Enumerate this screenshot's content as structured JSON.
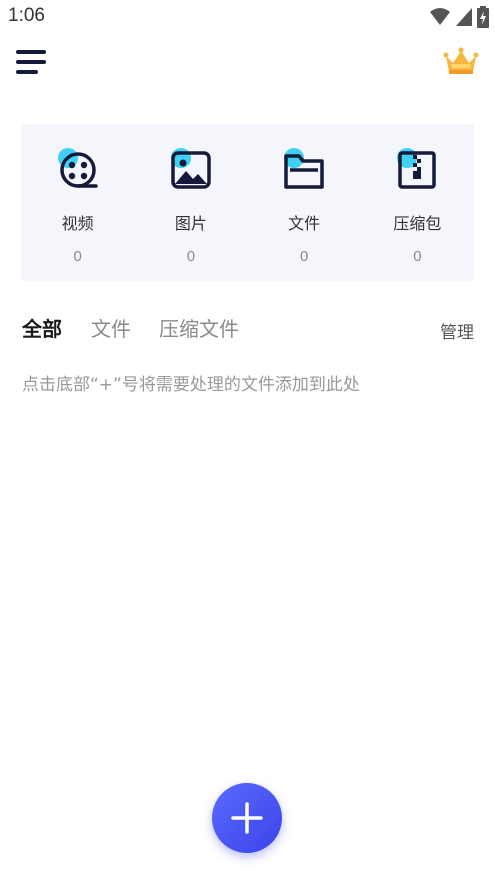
{
  "status_bar": {
    "time": "1:06",
    "icons": [
      "wifi-icon",
      "cellular-signal-icon",
      "battery-icon"
    ]
  },
  "topbar": {
    "menu_icon": "menu-icon",
    "vip_icon": "crown-icon"
  },
  "categories": [
    {
      "label": "视频",
      "count": "0",
      "icon": "video-reel-icon"
    },
    {
      "label": "图片",
      "count": "0",
      "icon": "image-icon"
    },
    {
      "label": "文件",
      "count": "0",
      "icon": "folder-icon"
    },
    {
      "label": "压缩包",
      "count": "0",
      "icon": "zip-archive-icon"
    }
  ],
  "tabs": [
    {
      "label": "全部",
      "active": true
    },
    {
      "label": "文件",
      "active": false
    },
    {
      "label": "压缩文件",
      "active": false
    }
  ],
  "manage_label": "管理",
  "empty_hint": "点击底部“+”号将需要处理的文件添加到此处",
  "fab_icon": "plus-icon",
  "colors": {
    "accent": "#3a43e8",
    "icon_highlight": "#3fd0f5",
    "panel_bg": "#f4f6fb",
    "icon_dark": "#151a3a",
    "crown": "#f5b83d"
  }
}
